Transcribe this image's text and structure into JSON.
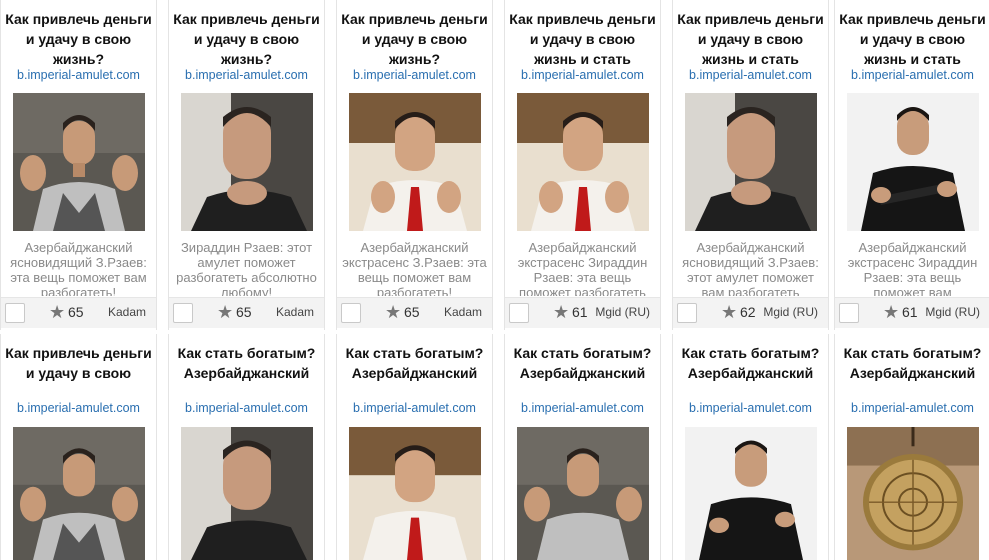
{
  "cards_row1": [
    {
      "title": "Как привлечь деньги и удачу в свою жизнь?",
      "domain": "b.imperial-amulet.com",
      "desc": "Азербайджанский ясновидящий З.Рзаев: эта вещь поможет вам разбогатеть!",
      "score": "65",
      "network": "Kadam",
      "photo": "man-vest-gesture"
    },
    {
      "title": "Как привлечь деньги и удачу в свою жизнь?",
      "domain": "b.imperial-amulet.com",
      "desc": "Зираддин Рзаев: этот амулет поможет разбогатеть абсолютно любому!",
      "score": "65",
      "network": "Kadam",
      "photo": "man-chin-hand"
    },
    {
      "title": "Как привлечь деньги и удачу в свою жизнь?",
      "domain": "b.imperial-amulet.com",
      "desc": "Азербайджанский экстрасенс З.Рзаев: эта вещь поможет вам разбогатеть!",
      "score": "65",
      "network": "Kadam",
      "photo": "man-red-tie"
    },
    {
      "title": "Как привлечь деньги и удачу в свою жизнь и стать богатым?",
      "domain": "b.imperial-amulet.com",
      "desc": "Азербайджанский экстрасенс Зираддин Рзаев: эта вещь поможет разбогатеть",
      "score": "61",
      "network": "Mgid (RU)",
      "photo": "man-red-tie"
    },
    {
      "title": "Как привлечь деньги и удачу в свою жизнь и стать богатым?",
      "domain": "b.imperial-amulet.com",
      "desc": "Азербайджанский ясновидящий З.Рзаев: этот амулет поможет вам разбогатеть",
      "score": "62",
      "network": "Mgid (RU)",
      "photo": "man-chin-hand"
    },
    {
      "title": "Как привлечь деньги и удачу в свою жизнь и стать богатым?",
      "domain": "b.imperial-amulet.com",
      "desc": "Азербайджанский экстрасенс Зираддин Рзаев: эта вещь поможет вам",
      "score": "61",
      "network": "Mgid (RU)",
      "photo": "man-crossed-arms"
    }
  ],
  "cards_row2": [
    {
      "title": "Как привлечь деньги и удачу в свою жизнь и стать богатым?",
      "domain": "b.imperial-amulet.com",
      "photo": "man-vest-gesture"
    },
    {
      "title": "Как стать богатым? Азербайджанский экстрасенс Зираддин",
      "domain": "b.imperial-amulet.com",
      "photo": "man-chin-hand"
    },
    {
      "title": "Как стать богатым? Азербайджанский экстрасенс Зираддин",
      "domain": "b.imperial-amulet.com",
      "photo": "man-red-tie"
    },
    {
      "title": "Как стать богатым? Азербайджанский ясновидящий З.Рзаев",
      "domain": "b.imperial-amulet.com",
      "photo": "man-vest-gesture"
    },
    {
      "title": "Как стать богатым? Азербайджанский экстрасенс Зираддин",
      "domain": "b.imperial-amulet.com",
      "photo": "man-crossed-arms"
    },
    {
      "title": "Как стать богатым? Азербайджанский экстрасенс советует",
      "domain": "b.imperial-amulet.com",
      "photo": "amulet-coin"
    }
  ]
}
